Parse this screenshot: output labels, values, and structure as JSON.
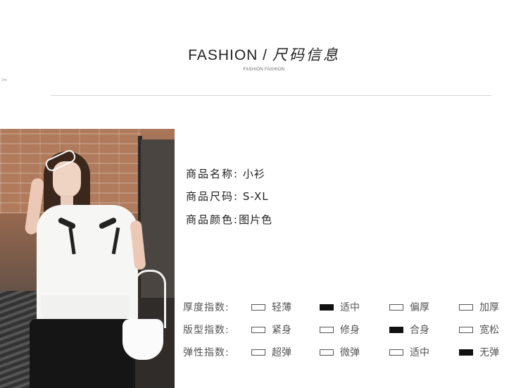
{
  "header": {
    "title_en": "FASHION",
    "title_sep": " / ",
    "title_cn": "尺码信息",
    "subtitle": "FASHION FASHION"
  },
  "product": {
    "name_label": "商品名称:",
    "name_value": "小衫",
    "size_label": "商品尺码:",
    "size_value": "S-XL",
    "color_label": "商品颜色:",
    "color_value": "图片色"
  },
  "params": [
    {
      "label": "厚度指数:",
      "options": [
        {
          "text": "轻薄",
          "selected": false
        },
        {
          "text": "适中",
          "selected": true
        },
        {
          "text": "偏厚",
          "selected": false
        },
        {
          "text": "加厚",
          "selected": false
        }
      ]
    },
    {
      "label": "版型指数:",
      "options": [
        {
          "text": "紧身",
          "selected": false
        },
        {
          "text": "修身",
          "selected": false
        },
        {
          "text": "合身",
          "selected": true
        },
        {
          "text": "宽松",
          "selected": false
        }
      ]
    },
    {
      "label": "弹性指数:",
      "options": [
        {
          "text": "超弹",
          "selected": false
        },
        {
          "text": "微弹",
          "selected": false
        },
        {
          "text": "适中",
          "selected": false
        },
        {
          "text": "无弹",
          "selected": true
        }
      ]
    }
  ],
  "colors": {
    "selected_box": "#111111",
    "divider": "#d6d6d6"
  },
  "icons": {
    "scissors": "scissors-icon"
  }
}
